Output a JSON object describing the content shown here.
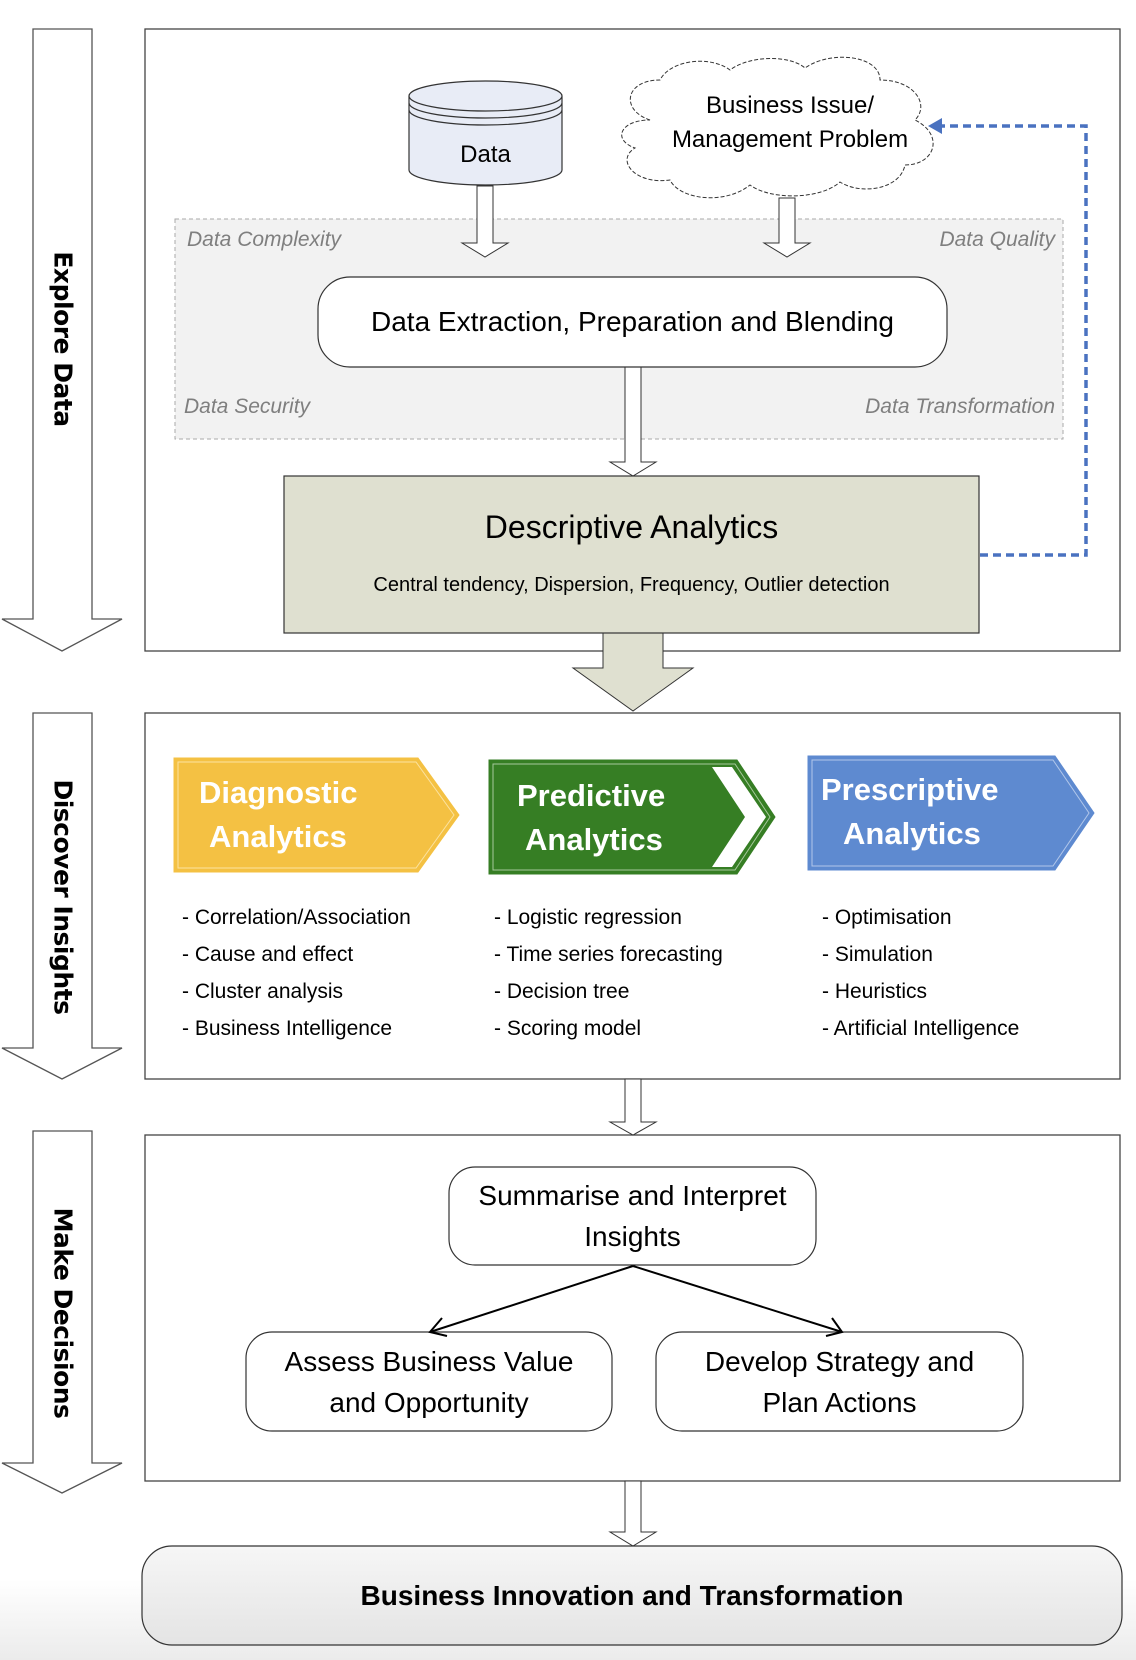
{
  "stages": {
    "explore": "Explore Data",
    "discover": "Discover Insights",
    "decide": "Make Decisions"
  },
  "explore": {
    "data_store": "Data",
    "business_issue_line1": "Business Issue/",
    "business_issue_line2": "Management Problem",
    "region_labels": {
      "top_left": "Data Complexity",
      "top_right": "Data Quality",
      "bottom_left": "Data Security",
      "bottom_right": "Data Transformation"
    },
    "extraction": "Data Extraction, Preparation and Blending",
    "descriptive": {
      "title": "Descriptive Analytics",
      "subtitle": "Central tendency, Dispersion, Frequency, Outlier detection"
    }
  },
  "discover": {
    "diagnostic": {
      "title_line1": "Diagnostic",
      "title_line2": "Analytics",
      "items": [
        "- Correlation/Association",
        "- Cause and effect",
        "- Cluster analysis",
        "- Business Intelligence"
      ]
    },
    "predictive": {
      "title_line1": "Predictive",
      "title_line2": "Analytics",
      "items": [
        "- Logistic regression",
        "- Time series forecasting",
        "- Decision tree",
        "- Scoring model"
      ]
    },
    "prescriptive": {
      "title_line1": "Prescriptive",
      "title_line2": "Analytics",
      "items": [
        "- Optimisation",
        "- Simulation",
        "- Heuristics",
        "- Artificial Intelligence"
      ]
    }
  },
  "decide": {
    "summarise_line1": "Summarise and Interpret",
    "summarise_line2": "Insights",
    "assess_line1": "Assess Business Value",
    "assess_line2": "and Opportunity",
    "develop_line1": "Develop Strategy and",
    "develop_line2": "Plan Actions"
  },
  "outcome": "Business Innovation and Transformation",
  "colors": {
    "diagnostic": "#f4c143",
    "predictive": "#367e24",
    "prescriptive": "#5e8ad0",
    "descriptive_fill": "#dfe0d0",
    "feedback_line": "#4a72c0",
    "data_store_fill": "#e8ecf6",
    "region_fill": "#f2f2f2"
  }
}
